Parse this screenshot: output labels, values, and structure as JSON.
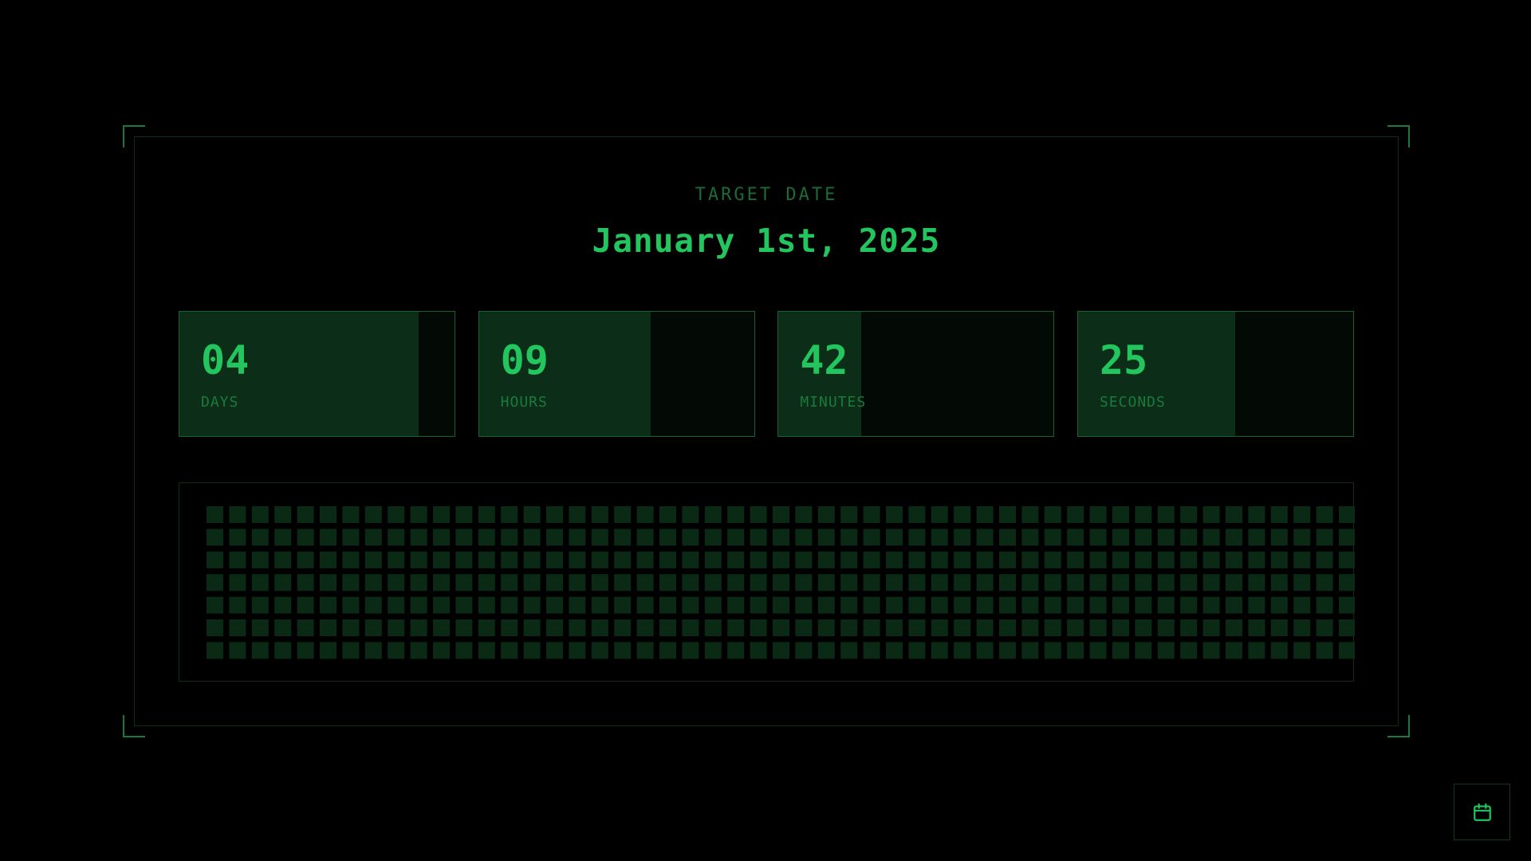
{
  "header": {
    "target_label": "TARGET DATE",
    "target_date": "January 1st, 2025"
  },
  "countdown": [
    {
      "key": "days",
      "value": "04",
      "label": "DAYS",
      "progress": 0.87
    },
    {
      "key": "hours",
      "value": "09",
      "label": "HOURS",
      "progress": 0.625
    },
    {
      "key": "minutes",
      "value": "42",
      "label": "MINUTES",
      "progress": 0.3
    },
    {
      "key": "seconds",
      "value": "25",
      "label": "SECONDS",
      "progress": 0.57
    }
  ],
  "day_grid": {
    "total_days": 365,
    "rows": 7,
    "columns": 53
  },
  "controls": {
    "calendar_button_icon": "calendar-icon"
  },
  "colors": {
    "accent": "#22c55e",
    "label": "#1a7a3c",
    "fill": "#0c2e18",
    "cell": "#0b2a16",
    "cell_dim": "#061a0d"
  }
}
